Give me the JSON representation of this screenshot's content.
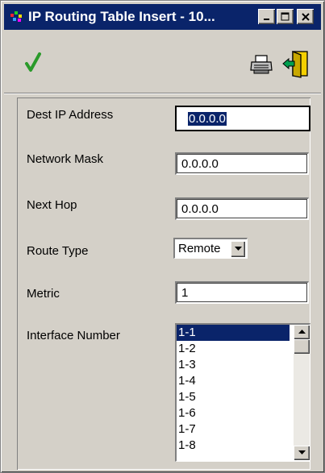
{
  "window": {
    "title": "IP Routing Table Insert - 10...",
    "title_bar_color": "#0a246a",
    "controls": [
      "minimize-icon",
      "maximize-icon",
      "close-icon"
    ]
  },
  "toolbar": {
    "buttons": [
      "check-icon",
      "printer-icon",
      "exit-door-icon"
    ],
    "check_color": "#2a9a2a"
  },
  "form": {
    "dest_ip": {
      "label": "Dest IP Address",
      "value": "0.0.0.0"
    },
    "network_mask": {
      "label": "Network Mask",
      "value": "0.0.0.0"
    },
    "next_hop": {
      "label": "Next Hop",
      "value": "0.0.0.0"
    },
    "route_type": {
      "label": "Route Type",
      "value": "Remote"
    },
    "metric": {
      "label": "Metric",
      "value": "1"
    },
    "interface_number": {
      "label": "Interface Number",
      "items": [
        "1-1",
        "1-2",
        "1-3",
        "1-4",
        "1-5",
        "1-6",
        "1-7",
        "1-8"
      ],
      "selected": "1-1"
    }
  }
}
